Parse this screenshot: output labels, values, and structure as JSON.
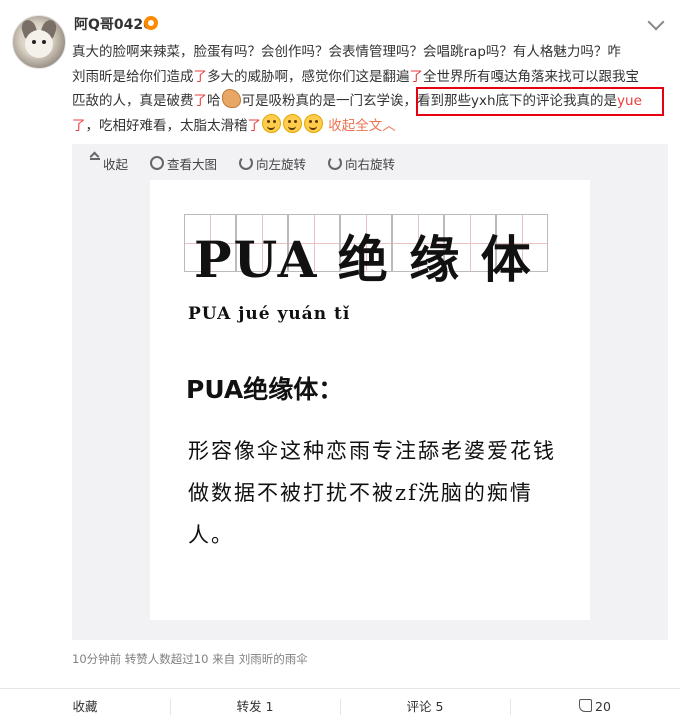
{
  "post": {
    "username": "阿Q哥0420",
    "text_line1": "真大的脸啊来辣菜，脸蛋有吗？会创作吗？会表情管理吗？会唱跳rap吗？有人格魅力吗？咋",
    "text_seg2a": "刘雨昕是给你们造成",
    "text_red1": "了",
    "text_seg2b": "多大的威胁啊，感觉你们这是翻遍",
    "text_red2": "了",
    "text_seg2c": "全世界所有嘎达角落来找可以跟我宝",
    "text_seg3a": "匹敌的人，真是破费",
    "text_red3": "了",
    "text_seg3b": "哈",
    "text_seg3c": "可是吸粉真的是一门玄学诶，看到那些yxh底下的评论我真的是",
    "text_red4": "yue",
    "text_red5": "了",
    "text_seg4a": "，吃相好难看，太脂太滑稽",
    "text_red6": "了",
    "collapse_label": "收起全文",
    "collapse_arrow": "︿"
  },
  "media_toolbar": {
    "collapse": "收起",
    "view_large": "查看大图",
    "rotate_left": "向左旋转",
    "rotate_right": "向右旋转"
  },
  "image": {
    "grid_title": "PUA 绝 缘 体",
    "pinyin": "PUA  jué  yuán  tǐ",
    "heading": "PUA绝缘体：",
    "body": "形容像伞这种恋雨专注舔老婆爱花钱做数据不被打扰不被zf洗脑的痴情人。"
  },
  "meta": {
    "time": "10分钟前",
    "reposts_note": "转赞人数超过10",
    "source_prefix": "来自",
    "source": "刘雨昕的雨伞"
  },
  "actions": {
    "favorite": "收藏",
    "repost": "转发 1",
    "comment": "评论 5",
    "like": "20"
  },
  "colors": {
    "accent_red": "#eb3c3c",
    "link_orange": "#eb7350",
    "highlight_box": "#e60012"
  }
}
